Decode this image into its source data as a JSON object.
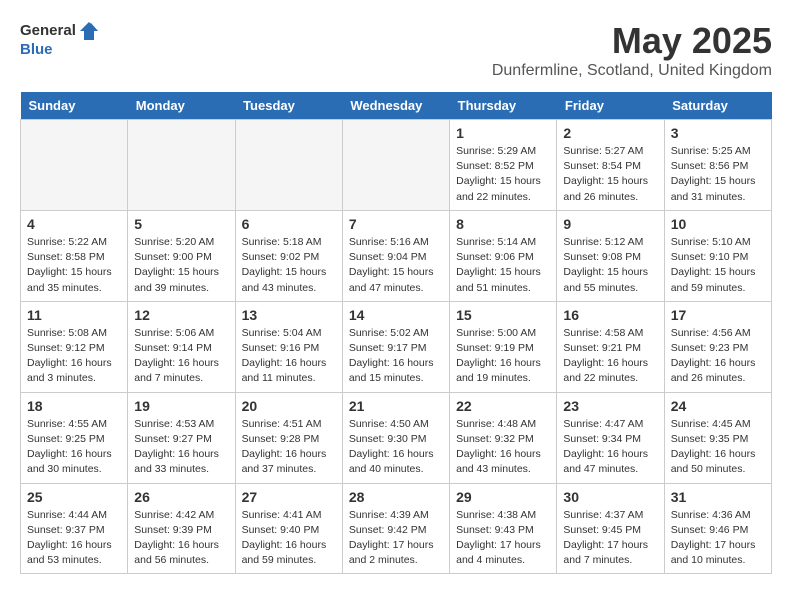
{
  "header": {
    "logo_general": "General",
    "logo_blue": "Blue",
    "month": "May 2025",
    "location": "Dunfermline, Scotland, United Kingdom"
  },
  "days_of_week": [
    "Sunday",
    "Monday",
    "Tuesday",
    "Wednesday",
    "Thursday",
    "Friday",
    "Saturday"
  ],
  "weeks": [
    [
      {
        "day": "",
        "empty": true
      },
      {
        "day": "",
        "empty": true
      },
      {
        "day": "",
        "empty": true
      },
      {
        "day": "",
        "empty": true
      },
      {
        "day": "1",
        "sunrise": "5:29 AM",
        "sunset": "8:52 PM",
        "daylight": "15 hours and 22 minutes."
      },
      {
        "day": "2",
        "sunrise": "5:27 AM",
        "sunset": "8:54 PM",
        "daylight": "15 hours and 26 minutes."
      },
      {
        "day": "3",
        "sunrise": "5:25 AM",
        "sunset": "8:56 PM",
        "daylight": "15 hours and 31 minutes."
      }
    ],
    [
      {
        "day": "4",
        "sunrise": "5:22 AM",
        "sunset": "8:58 PM",
        "daylight": "15 hours and 35 minutes."
      },
      {
        "day": "5",
        "sunrise": "5:20 AM",
        "sunset": "9:00 PM",
        "daylight": "15 hours and 39 minutes."
      },
      {
        "day": "6",
        "sunrise": "5:18 AM",
        "sunset": "9:02 PM",
        "daylight": "15 hours and 43 minutes."
      },
      {
        "day": "7",
        "sunrise": "5:16 AM",
        "sunset": "9:04 PM",
        "daylight": "15 hours and 47 minutes."
      },
      {
        "day": "8",
        "sunrise": "5:14 AM",
        "sunset": "9:06 PM",
        "daylight": "15 hours and 51 minutes."
      },
      {
        "day": "9",
        "sunrise": "5:12 AM",
        "sunset": "9:08 PM",
        "daylight": "15 hours and 55 minutes."
      },
      {
        "day": "10",
        "sunrise": "5:10 AM",
        "sunset": "9:10 PM",
        "daylight": "15 hours and 59 minutes."
      }
    ],
    [
      {
        "day": "11",
        "sunrise": "5:08 AM",
        "sunset": "9:12 PM",
        "daylight": "16 hours and 3 minutes."
      },
      {
        "day": "12",
        "sunrise": "5:06 AM",
        "sunset": "9:14 PM",
        "daylight": "16 hours and 7 minutes."
      },
      {
        "day": "13",
        "sunrise": "5:04 AM",
        "sunset": "9:16 PM",
        "daylight": "16 hours and 11 minutes."
      },
      {
        "day": "14",
        "sunrise": "5:02 AM",
        "sunset": "9:17 PM",
        "daylight": "16 hours and 15 minutes."
      },
      {
        "day": "15",
        "sunrise": "5:00 AM",
        "sunset": "9:19 PM",
        "daylight": "16 hours and 19 minutes."
      },
      {
        "day": "16",
        "sunrise": "4:58 AM",
        "sunset": "9:21 PM",
        "daylight": "16 hours and 22 minutes."
      },
      {
        "day": "17",
        "sunrise": "4:56 AM",
        "sunset": "9:23 PM",
        "daylight": "16 hours and 26 minutes."
      }
    ],
    [
      {
        "day": "18",
        "sunrise": "4:55 AM",
        "sunset": "9:25 PM",
        "daylight": "16 hours and 30 minutes."
      },
      {
        "day": "19",
        "sunrise": "4:53 AM",
        "sunset": "9:27 PM",
        "daylight": "16 hours and 33 minutes."
      },
      {
        "day": "20",
        "sunrise": "4:51 AM",
        "sunset": "9:28 PM",
        "daylight": "16 hours and 37 minutes."
      },
      {
        "day": "21",
        "sunrise": "4:50 AM",
        "sunset": "9:30 PM",
        "daylight": "16 hours and 40 minutes."
      },
      {
        "day": "22",
        "sunrise": "4:48 AM",
        "sunset": "9:32 PM",
        "daylight": "16 hours and 43 minutes."
      },
      {
        "day": "23",
        "sunrise": "4:47 AM",
        "sunset": "9:34 PM",
        "daylight": "16 hours and 47 minutes."
      },
      {
        "day": "24",
        "sunrise": "4:45 AM",
        "sunset": "9:35 PM",
        "daylight": "16 hours and 50 minutes."
      }
    ],
    [
      {
        "day": "25",
        "sunrise": "4:44 AM",
        "sunset": "9:37 PM",
        "daylight": "16 hours and 53 minutes."
      },
      {
        "day": "26",
        "sunrise": "4:42 AM",
        "sunset": "9:39 PM",
        "daylight": "16 hours and 56 minutes."
      },
      {
        "day": "27",
        "sunrise": "4:41 AM",
        "sunset": "9:40 PM",
        "daylight": "16 hours and 59 minutes."
      },
      {
        "day": "28",
        "sunrise": "4:39 AM",
        "sunset": "9:42 PM",
        "daylight": "17 hours and 2 minutes."
      },
      {
        "day": "29",
        "sunrise": "4:38 AM",
        "sunset": "9:43 PM",
        "daylight": "17 hours and 4 minutes."
      },
      {
        "day": "30",
        "sunrise": "4:37 AM",
        "sunset": "9:45 PM",
        "daylight": "17 hours and 7 minutes."
      },
      {
        "day": "31",
        "sunrise": "4:36 AM",
        "sunset": "9:46 PM",
        "daylight": "17 hours and 10 minutes."
      }
    ]
  ]
}
